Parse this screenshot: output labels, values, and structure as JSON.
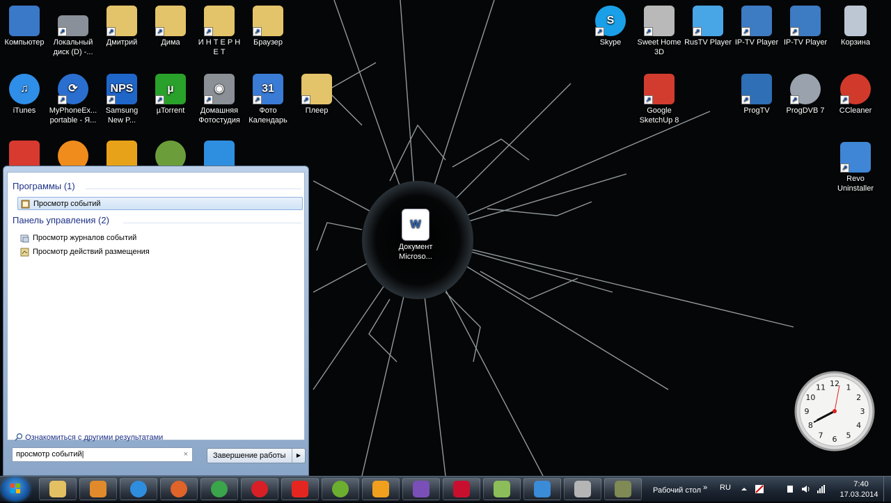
{
  "desktop": {
    "icons_left": [
      {
        "label": "Компьютер",
        "color": "#3a78c8"
      },
      {
        "label": "Локальный диск (D) -...",
        "color": "#8a9099"
      },
      {
        "label": "Дмитрий",
        "color": "#e4c46a"
      },
      {
        "label": "Дима",
        "color": "#e4c46a"
      },
      {
        "label": "И Н Т Е Р Н Е Т",
        "color": "#e4c46a"
      },
      {
        "label": "Браузер",
        "color": "#e4c46a"
      },
      {
        "label": "iTunes",
        "color": "#2f8ee8"
      },
      {
        "label": "MyPhoneEx... portable - Я...",
        "color": "#2a6fd0"
      },
      {
        "label": "Samsung New P...",
        "color": "#1f66c9"
      },
      {
        "label": "µTorrent",
        "color": "#2aa12a"
      },
      {
        "label": "Домашняя Фотостудия",
        "color": "#8b8f96"
      },
      {
        "label": "Фото Календарь",
        "color": "#3a7bd5"
      },
      {
        "label": "Плеер",
        "color": "#e4c46a"
      }
    ],
    "icons_right": [
      {
        "label": "Skype",
        "color": "#1aa0e8"
      },
      {
        "label": "Sweet Home 3D",
        "color": "#b9b9b9"
      },
      {
        "label": "RusTV Player",
        "color": "#49a6e6"
      },
      {
        "label": "IP-TV Player",
        "color": "#3d7bc3"
      },
      {
        "label": "IP-TV Player",
        "color": "#3d7bc3"
      },
      {
        "label": "Корзина",
        "color": "#bcc7d3"
      },
      {
        "label": "Google SketchUp 8",
        "color": "#d23c2f"
      },
      {
        "label": "ProgTV",
        "color": "#2e6fb6"
      },
      {
        "label": "ProgDVB 7",
        "color": "#9aa3ad"
      },
      {
        "label": "CCleaner",
        "color": "#d13a2b"
      },
      {
        "label": "Revo Uninstaller",
        "color": "#3f86d6"
      }
    ],
    "center_icon": {
      "label": "Документ Microso...",
      "color": "#2c64b8"
    },
    "icon_words": {
      "nps": "NPS",
      "mu": "µ",
      "cal_day": "31",
      "skype_s": "S",
      "word_w": "W"
    },
    "row3_colors": [
      "#d83a2f",
      "#f08c1c",
      "#e8a21a",
      "#6b9e3a",
      "#2e8fe0"
    ]
  },
  "start_menu": {
    "group_programs": "Программы (1)",
    "group_control_panel": "Панель управления (2)",
    "program_results": [
      {
        "label": "Просмотр событий",
        "selected": true
      }
    ],
    "control_panel_results": [
      {
        "label": "Просмотр журналов событий"
      },
      {
        "label": "Просмотр действий размещения"
      }
    ],
    "more_results": "Ознакомиться с другими результатами",
    "search": {
      "value": "просмотр событий",
      "clear": "×"
    },
    "shutdown": {
      "label": "Завершение работы",
      "arrow": "▶"
    }
  },
  "taskbar": {
    "pinned": [
      {
        "name": "explorer",
        "color": "#e3c163"
      },
      {
        "name": "media-player",
        "color": "#e08a2c"
      },
      {
        "name": "internet-explorer",
        "color": "#2f8de0"
      },
      {
        "name": "firefox",
        "color": "#e0632a"
      },
      {
        "name": "chrome",
        "color": "#3aa54a"
      },
      {
        "name": "opera",
        "color": "#d81f26"
      },
      {
        "name": "yandex-browser",
        "color": "#e52620"
      },
      {
        "name": "app-green-ball",
        "color": "#6cae2f"
      },
      {
        "name": "app-orange",
        "color": "#f0a01c"
      },
      {
        "name": "visual-studio",
        "color": "#7b4fb8"
      },
      {
        "name": "kaspersky",
        "color": "#c8102e"
      },
      {
        "name": "app-envelope",
        "color": "#8bbd59"
      },
      {
        "name": "app-network",
        "color": "#3a8bd8"
      },
      {
        "name": "app-phone",
        "color": "#b5b5b5"
      },
      {
        "name": "app-person",
        "color": "#7f8a55"
      }
    ],
    "desktop_toolbar": "Рабочий стол",
    "toolbar_chevron": "»",
    "language": "RU",
    "time": "7:40",
    "date": "17.03.2014"
  },
  "clock_gadget": {
    "numbers": [
      "12",
      "1",
      "2",
      "3",
      "4",
      "5",
      "6",
      "7",
      "8",
      "9",
      "10",
      "11"
    ]
  }
}
